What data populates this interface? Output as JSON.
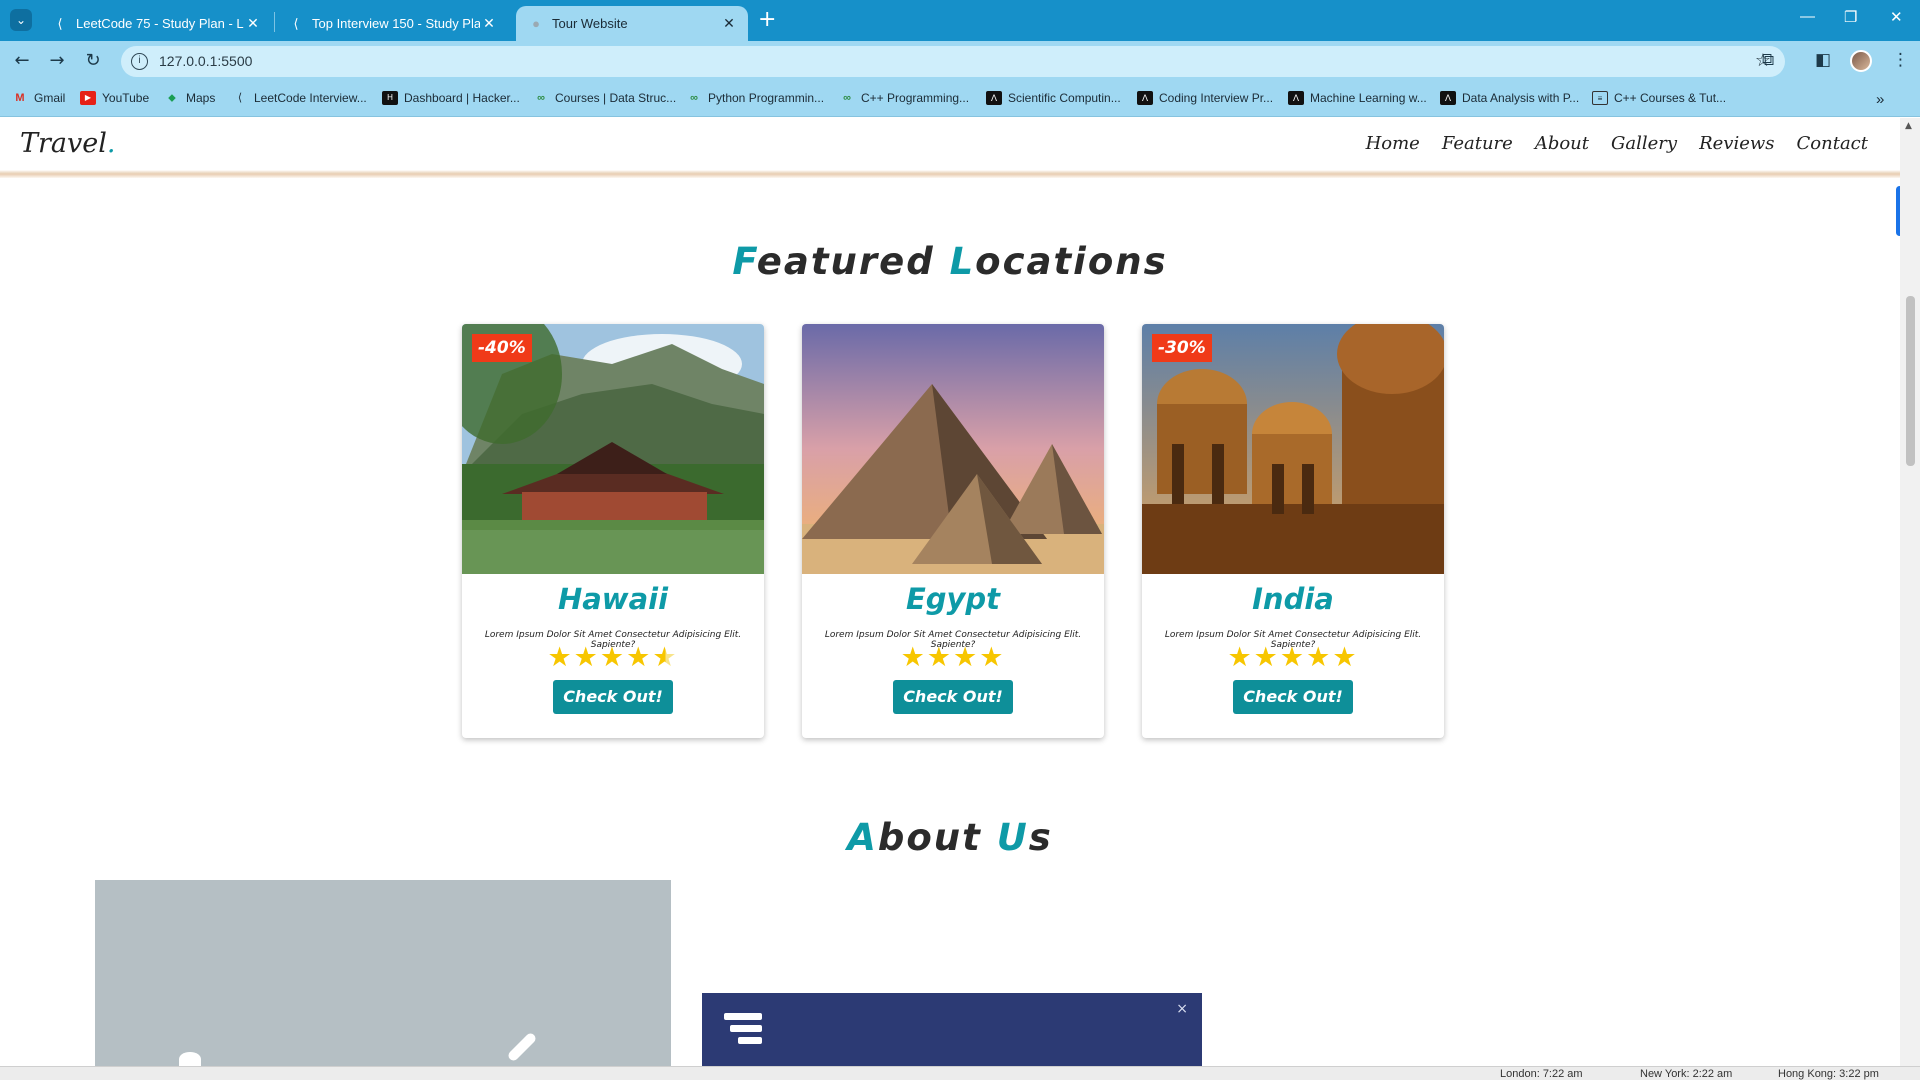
{
  "browser": {
    "tabs": [
      {
        "title": "LeetCode 75 - Study Plan - Lee",
        "active": false
      },
      {
        "title": "Top Interview 150 - Study Plan",
        "active": false
      },
      {
        "title": "Tour Website",
        "active": true
      }
    ],
    "url": "127.0.0.1:5500",
    "bookmarks": [
      {
        "label": "Gmail",
        "icon": "gmail-icon"
      },
      {
        "label": "YouTube",
        "icon": "youtube-icon"
      },
      {
        "label": "Maps",
        "icon": "maps-icon"
      },
      {
        "label": "LeetCode Interview...",
        "icon": "leetcode-icon"
      },
      {
        "label": "Dashboard | Hacker...",
        "icon": "hackerrank-icon"
      },
      {
        "label": "Courses | Data Struc...",
        "icon": "gfg-icon"
      },
      {
        "label": "Python Programmin...",
        "icon": "gfg-icon"
      },
      {
        "label": "C++ Programming...",
        "icon": "gfg-icon"
      },
      {
        "label": "Scientific Computin...",
        "icon": "fcc-icon"
      },
      {
        "label": "Coding Interview Pr...",
        "icon": "fcc-icon"
      },
      {
        "label": "Machine Learning w...",
        "icon": "fcc-icon"
      },
      {
        "label": "Data Analysis with P...",
        "icon": "fcc-icon"
      },
      {
        "label": "C++ Courses & Tut...",
        "icon": "doc-icon"
      }
    ]
  },
  "site": {
    "logo_text": "Travel",
    "logo_dot": ".",
    "nav": [
      "Home",
      "Feature",
      "About",
      "Gallery",
      "Reviews",
      "Contact"
    ]
  },
  "featured": {
    "title_first": "F",
    "title_rest1": "eatured ",
    "title_second": "L",
    "title_rest2": "ocations",
    "cards": [
      {
        "name": "Hawaii",
        "discount": "-40%",
        "desc": "Lorem Ipsum Dolor Sit Amet Consectetur Adipisicing Elit. Sapiente?",
        "rating": 4.5,
        "cta": "Check Out!"
      },
      {
        "name": "Egypt",
        "discount": "",
        "desc": "Lorem Ipsum Dolor Sit Amet Consectetur Adipisicing Elit. Sapiente?",
        "rating": 4,
        "cta": "Check Out!"
      },
      {
        "name": "India",
        "discount": "-30%",
        "desc": "Lorem Ipsum Dolor Sit Amet Consectetur Adipisicing Elit. Sapiente?",
        "rating": 5,
        "cta": "Check Out!"
      }
    ]
  },
  "about": {
    "title_first": "A",
    "title_rest1": "bout ",
    "title_second": "U",
    "title_rest2": "s"
  },
  "popup": {
    "close": "×"
  },
  "clocks": [
    "London: 7:22 am",
    "New York: 2:22 am",
    "Hong Kong: 3:22 pm"
  ],
  "colors": {
    "accent": "#0e9aa7",
    "discount": "#f03a18",
    "star": "#f7c600",
    "tabstrip": "#1690c9",
    "toolbar": "#9fd8f2"
  }
}
